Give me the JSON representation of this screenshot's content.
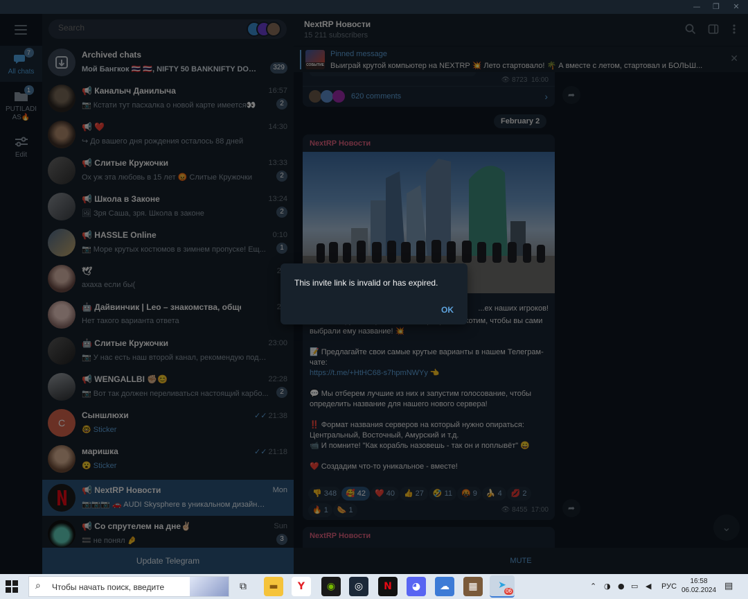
{
  "window": {
    "minimize": "—",
    "restore": "❐",
    "close": "✕"
  },
  "rail": {
    "folders": [
      {
        "label": "All chats",
        "badge": "7"
      },
      {
        "label": "PUTILADIAS🔥",
        "badge": "1"
      },
      {
        "label": "Edit",
        "badge": ""
      }
    ]
  },
  "search": {
    "placeholder": "Search"
  },
  "chats": [
    {
      "name": "Archived chats",
      "preview": "Мой Бангкок 🇹🇭 🇹🇭, NIFTY 50 BANKNIFTY DOMI...",
      "time": "",
      "unread": "329"
    },
    {
      "name": "📢 Каналыч Данилыча",
      "preview": "📷 Кстати тут пасхалка о новой карте имеется👀",
      "time": "16:57",
      "unread": "2"
    },
    {
      "name": "📢 ❤️",
      "preview": "↪ До вашего дня рождения осталось 88 дней",
      "time": "14:30",
      "unread": ""
    },
    {
      "name": "📢 Слитые Кружочки",
      "preview": "Ох уж эта любовь в 15 лет 😡 Слитые Кружочки",
      "time": "13:33",
      "unread": "2"
    },
    {
      "name": "📢 Школа в Законе",
      "preview": "🖼 Зря Саша, зря. Школа в законе",
      "time": "13:24",
      "unread": "2"
    },
    {
      "name": "📢 HASSLE Online",
      "preview": "📷 Море крутых костюмов в зимнем пропуске! Ещ...",
      "time": "0:10",
      "unread": "1"
    },
    {
      "name": "🕊",
      "preview": "ахаха если бы(",
      "time": "23:",
      "unread": ""
    },
    {
      "name": "🤖 Дайвинчик | Leo – знакомства, общение и ...",
      "preview": "Нет такого варианта ответа",
      "time": "23:",
      "unread": ""
    },
    {
      "name": "🤖 Слитые Кружочки",
      "preview": "📷 У нас есть наш второй канал, рекомендую подписа...",
      "time": "23:00",
      "unread": ""
    },
    {
      "name": "📢 WENGALLBI ✊🏼😊",
      "preview": "📷 Вот так должен переливаться настоящий карбо...",
      "time": "22:28",
      "unread": "2"
    },
    {
      "name": "Сыншлюхи",
      "preview": "🤓 Sticker",
      "time": "21:38",
      "unread": ""
    },
    {
      "name": "маришка",
      "preview": "😮 Sticker",
      "time": "21:18",
      "unread": ""
    },
    {
      "name": "📢 NextRP Новости",
      "preview": "📷📷📷 🚗 AUDI Skysphere в уникальном дизайне ...",
      "time": "Mon",
      "unread": ""
    },
    {
      "name": "📢 Со спрутелем на дне✌🏻",
      "preview": "🟰 не понял 🤌",
      "time": "Sun",
      "unread": "3"
    }
  ],
  "avatar_letter": "С",
  "update_label": "Update Telegram",
  "header": {
    "title": "NextRP Новости",
    "subtitle": "15 211 subscribers"
  },
  "pinned": {
    "label": "Pinned message",
    "text": "Выиграй крутой компьютер на NEXTRP 💥 Лето стартовало! 🌴 А вместе с летом, стартовал и БОЛЬШ...",
    "thumb_text": "СОБЫТИЕ"
  },
  "msg1": {
    "views": "8723",
    "time": "16:00",
    "comments": "620 comments"
  },
  "date_pill": "February 2",
  "post": {
    "channel": "NextRP Новости",
    "hidden_top": "...ех наших игроков!",
    "paragraphs": [
      "Мы планируем открыть новый сервер и мы хотим, чтобы вы сами выбрали ему название! 💥",
      "📝 Предлагайте свои самые крутые варианты в нашем Телеграм-чате:",
      "💬 Мы отберем лучшие из них и запустим голосование, чтобы определить название для нашего нового сервера!",
      "‼️ Формат названия серверов на который нужно опираться: Центральный, Восточный, Амурский и т.д.",
      "📹 И помните! \"Как корабль назовешь - так он и поплывёт\" 😄",
      "❤️ Создадим что-то уникальное - вместе!"
    ],
    "link": "https://t.me/+HtHC68-s7hpmNWYy",
    "link_after": " 👈",
    "reactions": [
      {
        "emoji": "👎",
        "count": "348",
        "mine": false
      },
      {
        "emoji": "🥰",
        "count": "42",
        "mine": true
      },
      {
        "emoji": "❤️",
        "count": "40",
        "mine": false
      },
      {
        "emoji": "👍",
        "count": "27",
        "mine": false
      },
      {
        "emoji": "🤣",
        "count": "11",
        "mine": false
      },
      {
        "emoji": "🤬",
        "count": "9",
        "mine": false
      },
      {
        "emoji": "🍌",
        "count": "4",
        "mine": false
      },
      {
        "emoji": "💋",
        "count": "2",
        "mine": false
      },
      {
        "emoji": "🔥",
        "count": "1",
        "mine": false
      },
      {
        "emoji": "🌭",
        "count": "1",
        "mine": false
      }
    ],
    "views": "8455",
    "time": "17:00"
  },
  "next_post_channel": "NextRP Новости",
  "mute_label": "MUTE",
  "dialog": {
    "message": "This invite link is invalid or has expired.",
    "ok": "OK"
  },
  "taskbar": {
    "search_placeholder": "Чтобы начать поиск, введите",
    "lang": "РУС",
    "time": "16:58",
    "date": "06.02.2024",
    "telegram_badge": "06"
  },
  "colors": {
    "accent": "#5ea3dd",
    "selected": "#2b5278",
    "bg": "#0e1621",
    "panel": "#17212b",
    "channel_name": "#e0607e"
  }
}
